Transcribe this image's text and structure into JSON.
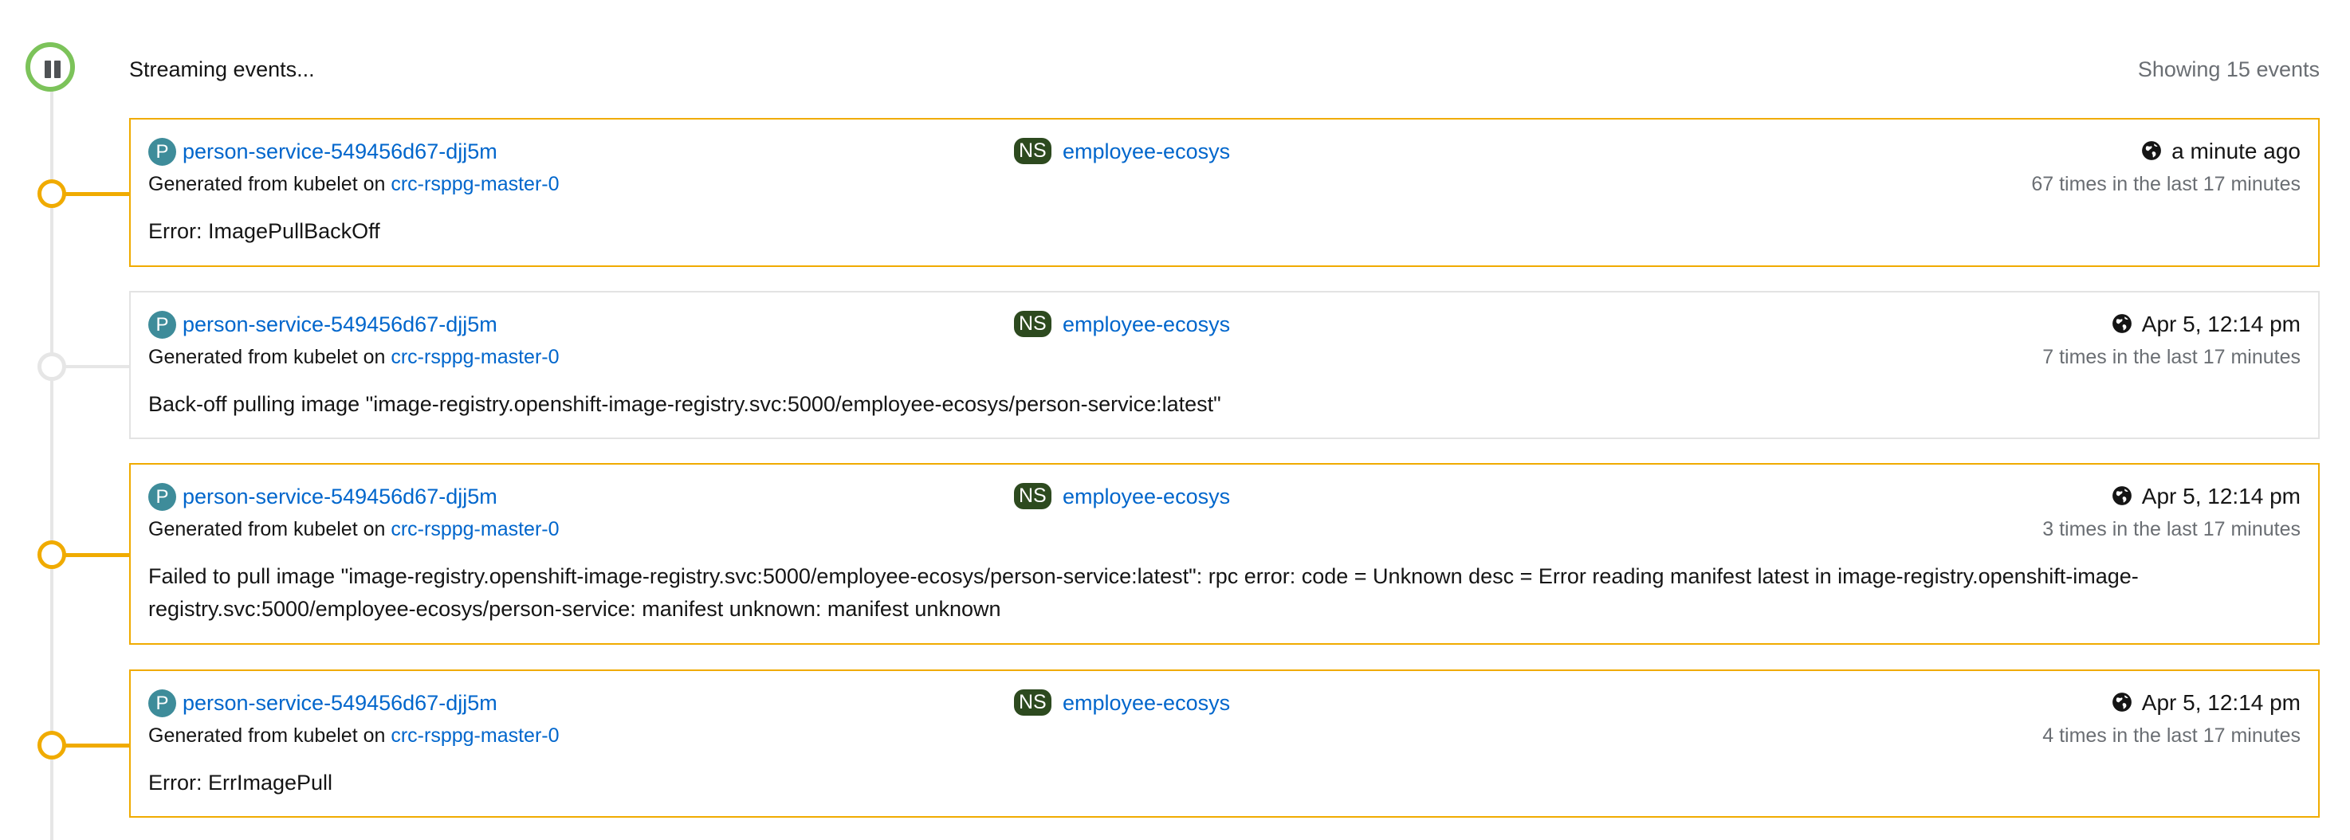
{
  "header": {
    "streaming_label": "Streaming events...",
    "showing_count": "Showing 15 events"
  },
  "icons": {
    "pause": "pause-icon",
    "globe": "globe-icon"
  },
  "colors": {
    "warning": "#f0ab00",
    "info_border": "#e3e3e3",
    "streaming_ring": "#7cc35a",
    "link": "#0066cc",
    "pod_badge": "#3e8c9a",
    "namespace_badge": "#2d4a1f"
  },
  "events": [
    {
      "severity": "warning",
      "resource_badge": "P",
      "resource_name": "person-service-549456d67-djj5m",
      "namespace_badge": "NS",
      "namespace": "employee-ecosys",
      "timestamp": "a minute ago",
      "generated_prefix": "Generated from kubelet on",
      "node": "crc-rsppg-master-0",
      "count": "67 times in the last 17 minutes",
      "message": "Error: ImagePullBackOff"
    },
    {
      "severity": "info",
      "resource_badge": "P",
      "resource_name": "person-service-549456d67-djj5m",
      "namespace_badge": "NS",
      "namespace": "employee-ecosys",
      "timestamp": "Apr 5, 12:14 pm",
      "generated_prefix": "Generated from kubelet on",
      "node": "crc-rsppg-master-0",
      "count": "7 times in the last 17 minutes",
      "message": "Back-off pulling image \"image-registry.openshift-image-registry.svc:5000/employee-ecosys/person-service:latest\""
    },
    {
      "severity": "warning",
      "resource_badge": "P",
      "resource_name": "person-service-549456d67-djj5m",
      "namespace_badge": "NS",
      "namespace": "employee-ecosys",
      "timestamp": "Apr 5, 12:14 pm",
      "generated_prefix": "Generated from kubelet on",
      "node": "crc-rsppg-master-0",
      "count": "3 times in the last 17 minutes",
      "message": "Failed to pull image \"image-registry.openshift-image-registry.svc:5000/employee-ecosys/person-service:latest\": rpc error: code = Unknown desc = Error reading manifest latest in image-registry.openshift-image-registry.svc:5000/employee-ecosys/person-service: manifest unknown: manifest unknown"
    },
    {
      "severity": "warning",
      "resource_badge": "P",
      "resource_name": "person-service-549456d67-djj5m",
      "namespace_badge": "NS",
      "namespace": "employee-ecosys",
      "timestamp": "Apr 5, 12:14 pm",
      "generated_prefix": "Generated from kubelet on",
      "node": "crc-rsppg-master-0",
      "count": "4 times in the last 17 minutes",
      "message": "Error: ErrImagePull"
    }
  ]
}
